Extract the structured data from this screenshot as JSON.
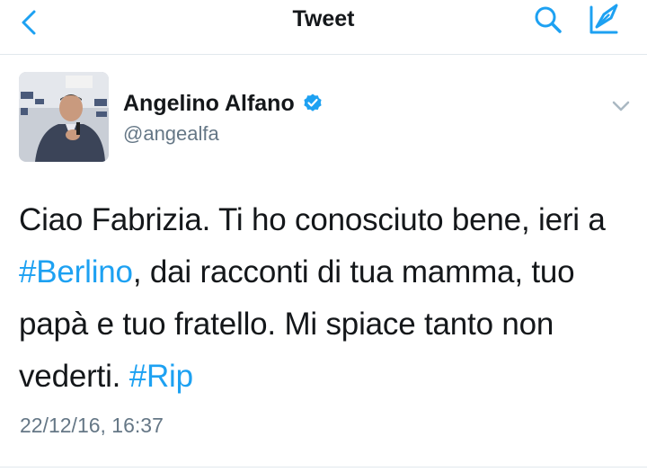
{
  "nav": {
    "title": "Tweet",
    "back_icon": "chevron-left-icon",
    "search_icon": "search-icon",
    "compose_icon": "compose-tweet-icon"
  },
  "tweet": {
    "author": {
      "display_name": "Angelino Alfano",
      "handle": "@angealfa",
      "verified": true
    },
    "text_segments": [
      {
        "text": "Ciao Fabrizia. Ti ho conosciuto bene, ieri a ",
        "hashtag": false
      },
      {
        "text": "#Berlino",
        "hashtag": true
      },
      {
        "text": ", dai racconti di tua mamma, tuo papà e tuo fratello. Mi spiace tanto non vederti. ",
        "hashtag": false
      },
      {
        "text": "#Rip",
        "hashtag": true
      }
    ],
    "timestamp": "22/12/16, 16:37"
  },
  "colors": {
    "accent": "#1da1f2",
    "text": "#14171a",
    "muted": "#657786",
    "divider": "#e1e8ed"
  }
}
